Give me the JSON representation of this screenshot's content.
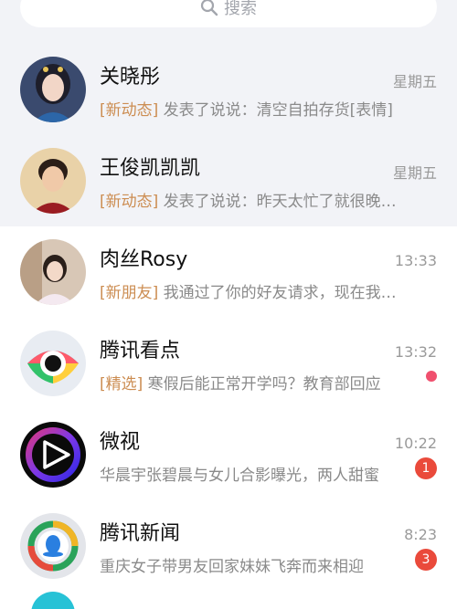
{
  "search": {
    "placeholder": "搜索"
  },
  "conversations": [
    {
      "name": "关晓彤",
      "time": "星期五",
      "tag": "[新动态]",
      "preview": " 发表了说说：清空自拍存货[表情]",
      "avatar_icon": "woman-portrait",
      "pinned": true
    },
    {
      "name": "王俊凯凯凯",
      "time": "星期五",
      "tag": "[新动态]",
      "preview": " 发表了说说：昨天太忙了就很晚才回",
      "avatar_icon": "man-portrait",
      "pinned": true
    },
    {
      "name": "肉丝Rosy",
      "time": "13:33",
      "tag": "[新朋友]",
      "preview": " 我通过了你的好友请求，现在我们可以聊天了",
      "avatar_icon": "girl-selfie",
      "pinned": false
    },
    {
      "name": "腾讯看点",
      "time": "13:32",
      "tag": "[精选]",
      "preview": " 寒假后能正常开学吗？教育部回应",
      "avatar_icon": "eye-logo",
      "pinned": false,
      "dot": true
    },
    {
      "name": "微视",
      "time": "10:22",
      "tag": "",
      "preview": "华晨宇张碧晨与女儿合影曝光，两人甜蜜",
      "avatar_icon": "play-logo",
      "pinned": false,
      "badge": "1"
    },
    {
      "name": "腾讯新闻",
      "time": "8:23",
      "tag": "",
      "preview": "重庆女子带男友回家妹妹飞奔而来相迎",
      "avatar_icon": "news-logo",
      "pinned": false,
      "badge": "3"
    }
  ],
  "colors": {
    "pinned_bg": "#f2f3f7",
    "tag": "#cc8d52",
    "badge": "#ea4a3b",
    "dot": "#f0506e"
  }
}
